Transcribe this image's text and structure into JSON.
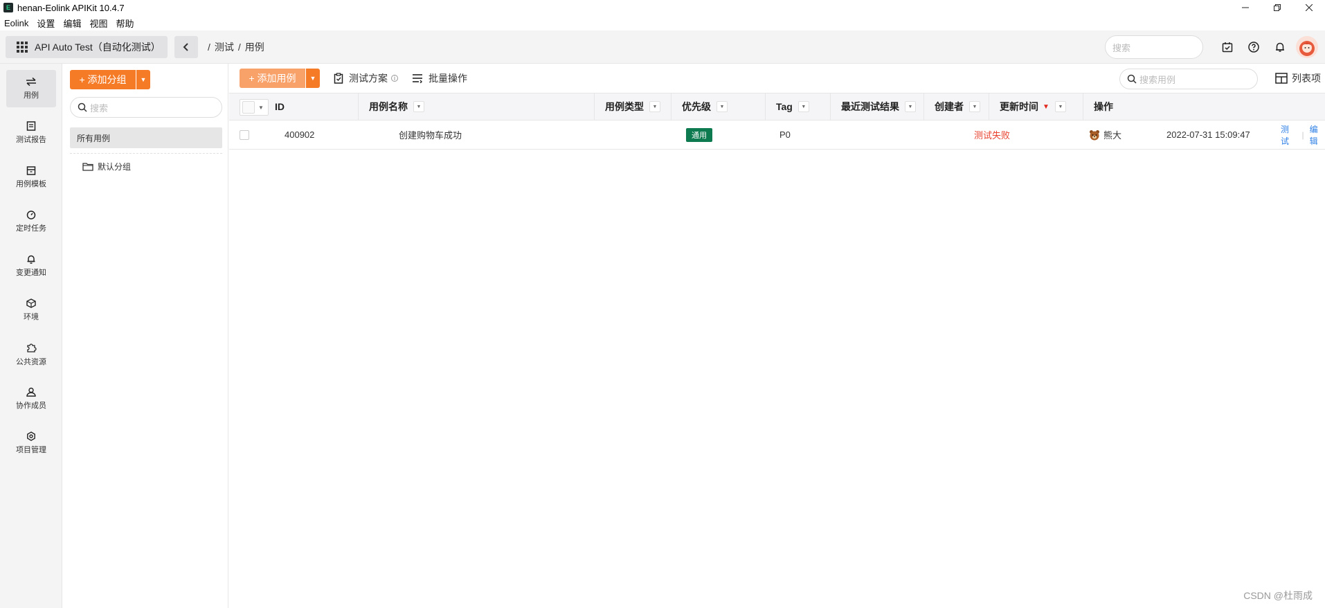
{
  "window": {
    "title": "henan-Eolink APIKit 10.4.7",
    "icon_glyph": "E"
  },
  "menu": [
    "Eolink",
    "设置",
    "编辑",
    "视图",
    "帮助"
  ],
  "topbar": {
    "project_name": "API Auto Test（自动化测试）",
    "breadcrumb": [
      "/",
      "测试",
      "/",
      "用例"
    ],
    "search_placeholder": "搜索"
  },
  "leftnav": [
    {
      "label": "用例",
      "icon": "arrows-icon",
      "active": true
    },
    {
      "label": "测试报告",
      "icon": "report-icon"
    },
    {
      "label": "用例模板",
      "icon": "template-icon"
    },
    {
      "label": "定时任务",
      "icon": "timer-icon"
    },
    {
      "label": "变更通知",
      "icon": "bell-icon"
    },
    {
      "label": "环境",
      "icon": "cube-icon"
    },
    {
      "label": "公共资源",
      "icon": "puzzle-icon"
    },
    {
      "label": "协作成员",
      "icon": "member-icon"
    },
    {
      "label": "项目管理",
      "icon": "settings-icon"
    }
  ],
  "groups": {
    "add_label": "+ 添加分组",
    "search_placeholder": "搜索",
    "all_label": "所有用例",
    "default_label": "默认分组"
  },
  "toolbar": {
    "add_case_label": "+ 添加用例",
    "plan_label": "测试方案",
    "batch_label": "批量操作",
    "search_placeholder": "搜索用例",
    "columns_label": "列表项"
  },
  "table": {
    "headers": {
      "id": "ID",
      "name": "用例名称",
      "type": "用例类型",
      "priority": "优先级",
      "tag": "Tag",
      "result": "最近测试结果",
      "creator": "创建者",
      "updated": "更新时间",
      "ops": "操作"
    },
    "rows": [
      {
        "id": "400902",
        "name": "创建购物车成功",
        "type": "通用",
        "priority": "P0",
        "tag": "",
        "result": "测试失败",
        "creator": "熊大",
        "updated": "2022-07-31 15:09:47",
        "op_test": "测试",
        "op_edit": "编辑"
      }
    ]
  },
  "colors": {
    "accent": "#f57b27",
    "fail": "#e8412d",
    "type_badge": "#0e7a4f",
    "link": "#2d7fe5"
  },
  "watermark": "CSDN @杜雨成"
}
